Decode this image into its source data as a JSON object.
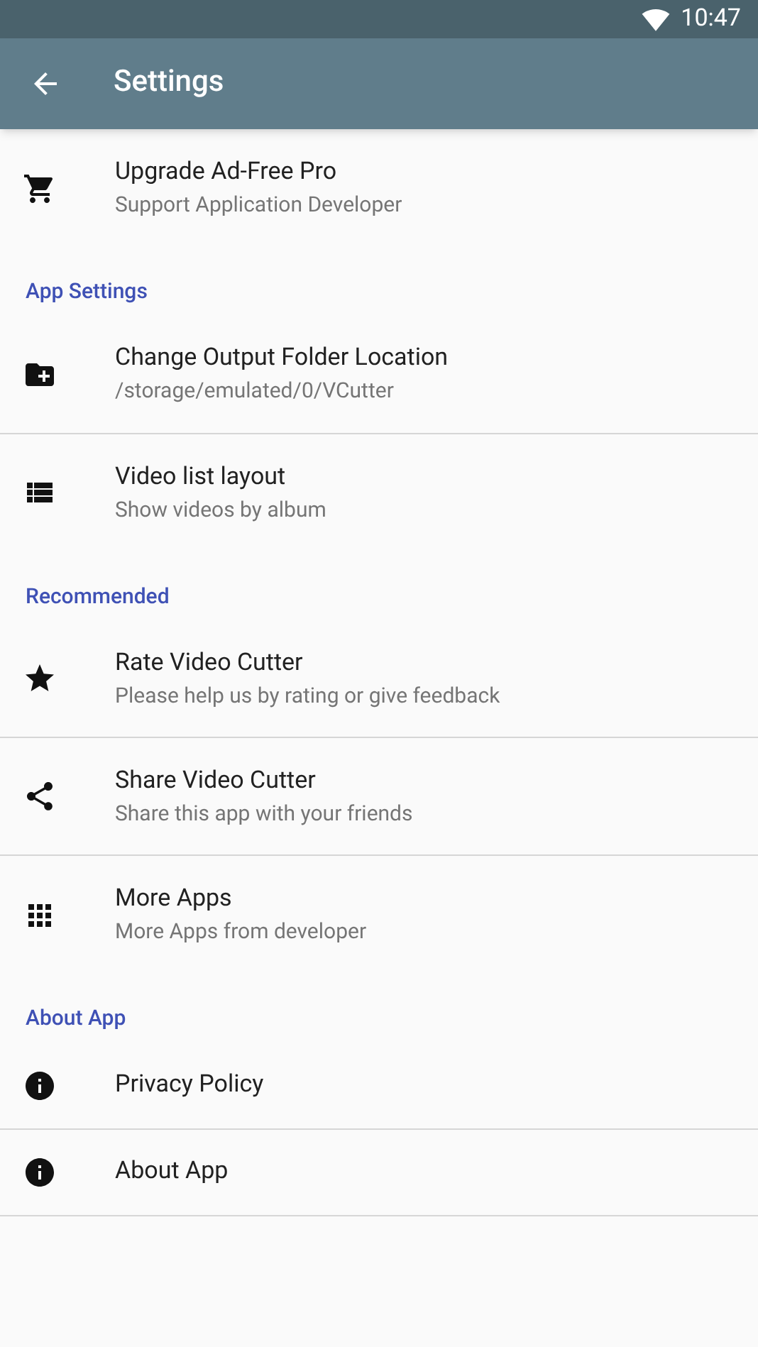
{
  "status_bar": {
    "time": "10:47"
  },
  "toolbar": {
    "title": "Settings"
  },
  "sections": [
    {
      "items": [
        {
          "title": "Upgrade Ad-Free Pro",
          "subtitle": "Support Application Developer",
          "divider": false
        }
      ]
    },
    {
      "header": "App Settings",
      "items": [
        {
          "title": "Change Output Folder Location",
          "subtitle": "/storage/emulated/0/VCutter",
          "divider": true
        },
        {
          "title": "Video list layout",
          "subtitle": "Show videos by album",
          "divider": false
        }
      ]
    },
    {
      "header": "Recommended",
      "items": [
        {
          "title": "Rate Video Cutter",
          "subtitle": "Please help us by rating or give feedback",
          "divider": true
        },
        {
          "title": "Share Video Cutter",
          "subtitle": "Share this app with your friends",
          "divider": true
        },
        {
          "title": "More Apps",
          "subtitle": "More Apps from developer",
          "divider": false
        }
      ]
    },
    {
      "header": "About App",
      "items": [
        {
          "title": "Privacy Policy",
          "divider": true
        },
        {
          "title": "About App",
          "divider": true
        }
      ]
    }
  ]
}
